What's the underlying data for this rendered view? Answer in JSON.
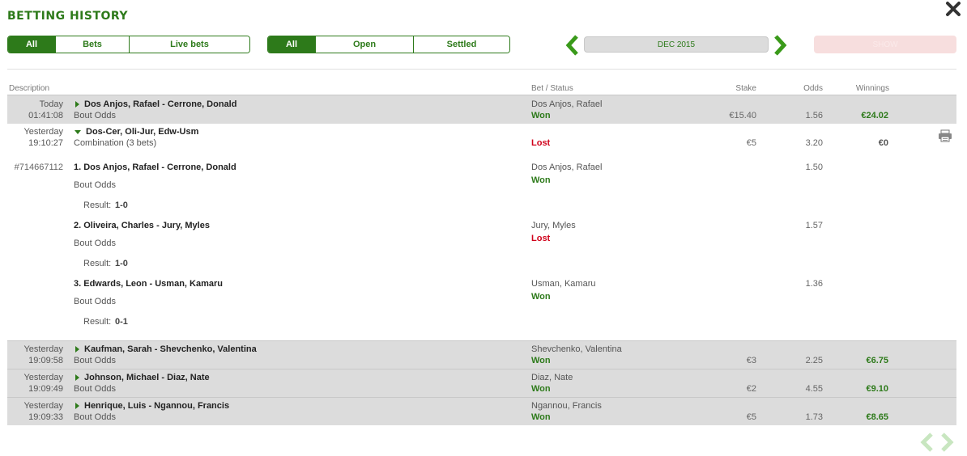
{
  "title": "BETTING HISTORY",
  "filters": {
    "type": [
      "All",
      "Bets",
      "Live bets"
    ],
    "status": [
      "All",
      "Open",
      "Settled"
    ]
  },
  "period": "DEC 2015",
  "show_label": "SHOW",
  "headers": {
    "description": "Description",
    "bet_status": "Bet / Status",
    "stake": "Stake",
    "odds": "Odds",
    "winnings": "Winnings"
  },
  "bets": [
    {
      "day": "Today",
      "time": "01:41:08",
      "event": "Dos Anjos, Rafael - Cerrone, Donald",
      "market": "Bout Odds",
      "selection": "Dos Anjos, Rafael",
      "status": "Won",
      "stake": "€15.40",
      "odds": "1.56",
      "winnings": "€24.02"
    },
    {
      "day": "Yesterday",
      "time": "19:10:27",
      "event": "Dos-Cer, Oli-Jur, Edw-Usm",
      "market": "Combination (3 bets)",
      "status": "Lost",
      "stake": "€5",
      "odds": "3.20",
      "winnings": "€0",
      "bet_id": "#714667112",
      "result_label": "Result:",
      "legs": [
        {
          "event": "1. Dos Anjos, Rafael - Cerrone, Donald",
          "market": "Bout Odds",
          "selection": "Dos Anjos, Rafael",
          "status": "Won",
          "odds": "1.50",
          "result": "1-0"
        },
        {
          "event": "2. Oliveira, Charles - Jury, Myles",
          "market": "Bout Odds",
          "selection": "Jury, Myles",
          "status": "Lost",
          "odds": "1.57",
          "result": "1-0"
        },
        {
          "event": "3. Edwards, Leon - Usman, Kamaru",
          "market": "Bout Odds",
          "selection": "Usman, Kamaru",
          "status": "Won",
          "odds": "1.36",
          "result": "0-1"
        }
      ]
    },
    {
      "day": "Yesterday",
      "time": "19:09:58",
      "event": "Kaufman, Sarah - Shevchenko, Valentina",
      "market": "Bout Odds",
      "selection": "Shevchenko, Valentina",
      "status": "Won",
      "stake": "€3",
      "odds": "2.25",
      "winnings": "€6.75"
    },
    {
      "day": "Yesterday",
      "time": "19:09:49",
      "event": "Johnson, Michael - Diaz, Nate",
      "market": "Bout Odds",
      "selection": "Diaz, Nate",
      "status": "Won",
      "stake": "€2",
      "odds": "4.55",
      "winnings": "€9.10"
    },
    {
      "day": "Yesterday",
      "time": "19:09:33",
      "event": "Henrique, Luis - Ngannou, Francis",
      "market": "Bout Odds",
      "selection": "Ngannou, Francis",
      "status": "Won",
      "stake": "€5",
      "odds": "1.73",
      "winnings": "€8.65"
    }
  ],
  "colors": {
    "accent": "#2d7a1a",
    "lost": "#d0021b",
    "row_bg": "#dcdcdc"
  }
}
